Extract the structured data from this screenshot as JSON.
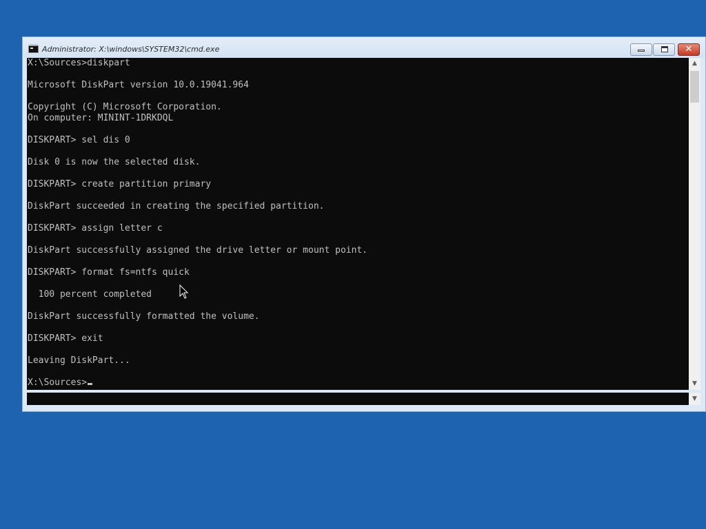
{
  "window": {
    "title": "Administrator: X:\\windows\\SYSTEM32\\cmd.exe",
    "close_glyph": "✕"
  },
  "console": {
    "lines": [
      "X:\\Sources>diskpart",
      "",
      "Microsoft DiskPart version 10.0.19041.964",
      "",
      "Copyright (C) Microsoft Corporation.",
      "On computer: MININT-1DRKDQL",
      "",
      "DISKPART> sel dis 0",
      "",
      "Disk 0 is now the selected disk.",
      "",
      "DISKPART> create partition primary",
      "",
      "DiskPart succeeded in creating the specified partition.",
      "",
      "DISKPART> assign letter c",
      "",
      "DiskPart successfully assigned the drive letter or mount point.",
      "",
      "DISKPART> format fs=ntfs quick",
      "",
      "  100 percent completed",
      "",
      "DiskPart successfully formatted the volume.",
      "",
      "DISKPART> exit",
      "",
      "Leaving DiskPart...",
      "",
      "X:\\Sources>"
    ]
  },
  "scrollbar": {
    "up_arrow": "▲",
    "down_arrow": "▼",
    "pane_arrow": "▼"
  }
}
